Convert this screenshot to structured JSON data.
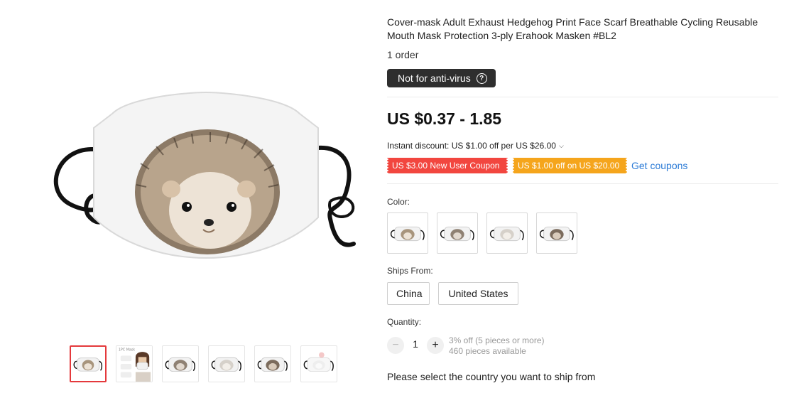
{
  "product": {
    "title": "Cover-mask Adult Exhaust Hedgehog Print Face Scarf Breathable Cycling Reusable Mouth Mask Protection 3-ply Erahook Masken #BL2",
    "orders": "1 order",
    "badge": "Not for anti-virus",
    "price": "US $0.37 - 1.85",
    "instant_discount": "Instant discount: US $1.00 off per US $26.00",
    "coupons": [
      {
        "label": "US $3.00 New User Coupon",
        "color": "#f2463f"
      },
      {
        "label": "US $1.00 off on US $20.00",
        "color": "#f5a51c"
      }
    ],
    "get_coupons": "Get coupons"
  },
  "options": {
    "color_label": "Color:",
    "color_count": 4,
    "ships_from_label": "Ships From:",
    "ships_from": [
      "China",
      "United States"
    ],
    "quantity_label": "Quantity:",
    "quantity": "1",
    "minus": "−",
    "plus": "+",
    "discount_note": "3% off (5 pieces or more)",
    "available": "460 pieces available"
  },
  "shipping_prompt": "Please select the country you want to ship from",
  "gallery": {
    "thumbnail_count": 6,
    "active_index": 0,
    "thumbnail_2_caption": "1PC Mask"
  },
  "icons": {
    "help": "question-circle-icon",
    "chevron": "chevron-down-icon"
  }
}
